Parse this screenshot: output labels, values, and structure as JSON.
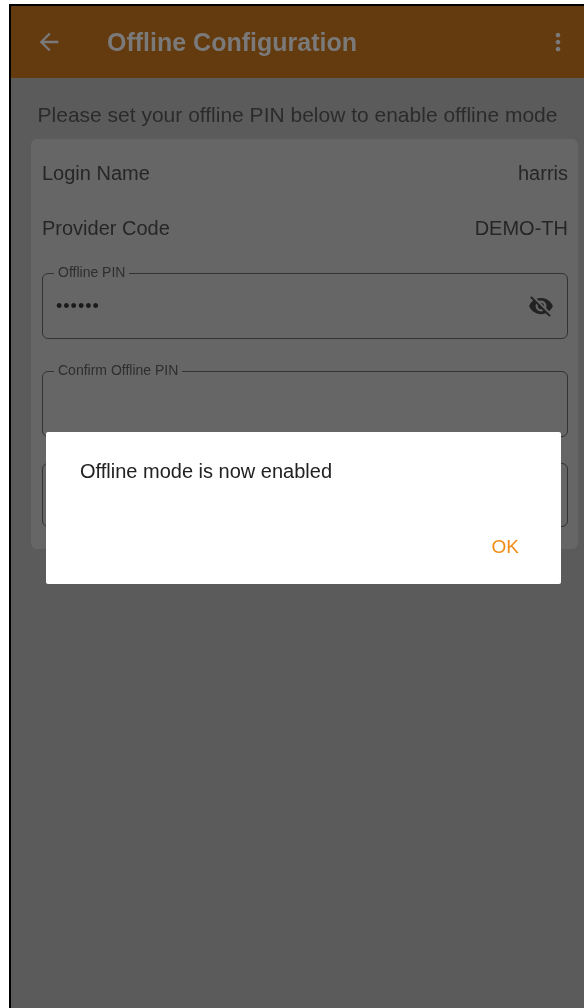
{
  "app_bar": {
    "title": "Offline Configuration"
  },
  "intro": "Please set your offline PIN below to enable offline mode",
  "details": [
    {
      "label": "Login Name",
      "value": "harris"
    },
    {
      "label": "Provider Code",
      "value": "DEMO-TH"
    }
  ],
  "pin_fields": [
    {
      "label": "Offline PIN",
      "value": "••••••",
      "masked": true
    },
    {
      "label": "Confirm Offline PIN"
    }
  ],
  "dialog": {
    "message": "Offline mode is now enabled",
    "button": "OK"
  }
}
